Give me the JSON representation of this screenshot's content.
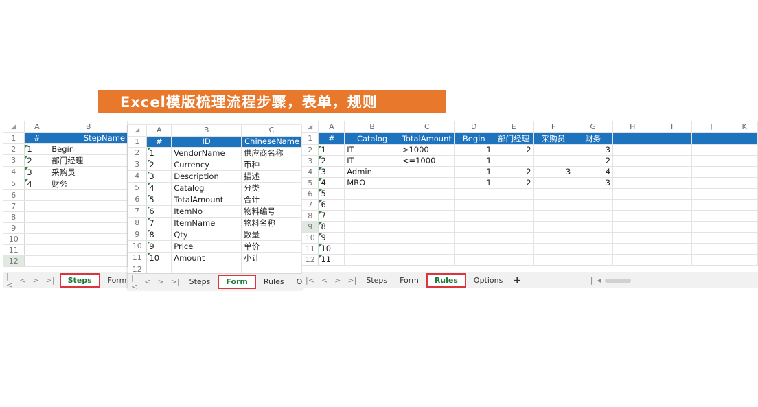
{
  "title": "Excel模版梳理流程步骤，表单，规则",
  "colors": {
    "banner": "#e8782b",
    "header_fill": "#1e73be",
    "active_tab": "#1e7a3a",
    "highlight_box": "#d9363e"
  },
  "steps": {
    "columns": [
      "A",
      "B"
    ],
    "header": [
      "#",
      "StepName"
    ],
    "rows": [
      [
        "1",
        "Begin"
      ],
      [
        "2",
        "部门经理"
      ],
      [
        "3",
        "采购员"
      ],
      [
        "4",
        "财务"
      ]
    ],
    "row_numbers": [
      "1",
      "2",
      "3",
      "4",
      "5",
      "6",
      "7",
      "8",
      "9",
      "10",
      "11",
      "12"
    ],
    "tabs": [
      "Steps",
      "Form"
    ],
    "active_tab": "Steps"
  },
  "form": {
    "columns": [
      "A",
      "B",
      "C"
    ],
    "header": [
      "#",
      "ID",
      "ChineseName"
    ],
    "rows": [
      [
        "1",
        "VendorName",
        "供应商名称"
      ],
      [
        "2",
        "Currency",
        "币种"
      ],
      [
        "3",
        "Description",
        "描述"
      ],
      [
        "4",
        "Catalog",
        "分类"
      ],
      [
        "5",
        "TotalAmount",
        "合计"
      ],
      [
        "6",
        "ItemNo",
        "物料编号"
      ],
      [
        "7",
        "ItemName",
        "物料名称"
      ],
      [
        "8",
        "Qty",
        "数量"
      ],
      [
        "9",
        "Price",
        "单价"
      ],
      [
        "10",
        "Amount",
        "小计"
      ]
    ],
    "row_numbers": [
      "1",
      "2",
      "3",
      "4",
      "5",
      "6",
      "7",
      "8",
      "9",
      "10",
      "11",
      "12"
    ],
    "tabs": [
      "Steps",
      "Form",
      "Rules",
      "Op"
    ],
    "active_tab": "Form"
  },
  "rules": {
    "columns": [
      "A",
      "B",
      "C",
      "D",
      "E",
      "F",
      "G",
      "H",
      "I",
      "J",
      "K"
    ],
    "header": [
      "#",
      "Catalog",
      "TotalAmount",
      "Begin",
      "部门经理",
      "采购员",
      "财务",
      "",
      "",
      "",
      ""
    ],
    "rows": [
      [
        "1",
        "IT",
        ">1000",
        "1",
        "2",
        "",
        "3"
      ],
      [
        "2",
        "IT",
        "<=1000",
        "1",
        "",
        "",
        "2"
      ],
      [
        "3",
        "Admin",
        "",
        "1",
        "2",
        "3",
        "4"
      ],
      [
        "4",
        "MRO",
        "",
        "1",
        "2",
        "",
        "3"
      ],
      [
        "5",
        "",
        "",
        "",
        "",
        "",
        ""
      ],
      [
        "6",
        "",
        "",
        "",
        "",
        "",
        ""
      ],
      [
        "7",
        "",
        "",
        "",
        "",
        "",
        ""
      ],
      [
        "8",
        "",
        "",
        "",
        "",
        "",
        ""
      ],
      [
        "9",
        "",
        "",
        "",
        "",
        "",
        ""
      ],
      [
        "10",
        "",
        "",
        "",
        "",
        "",
        ""
      ],
      [
        "11",
        "",
        "",
        "",
        "",
        "",
        ""
      ]
    ],
    "row_numbers": [
      "1",
      "2",
      "3",
      "4",
      "5",
      "6",
      "7",
      "8",
      "9",
      "10",
      "11",
      "12"
    ],
    "tabs": [
      "Steps",
      "Form",
      "Rules",
      "Options"
    ],
    "active_tab": "Rules",
    "add_sheet": "+"
  }
}
